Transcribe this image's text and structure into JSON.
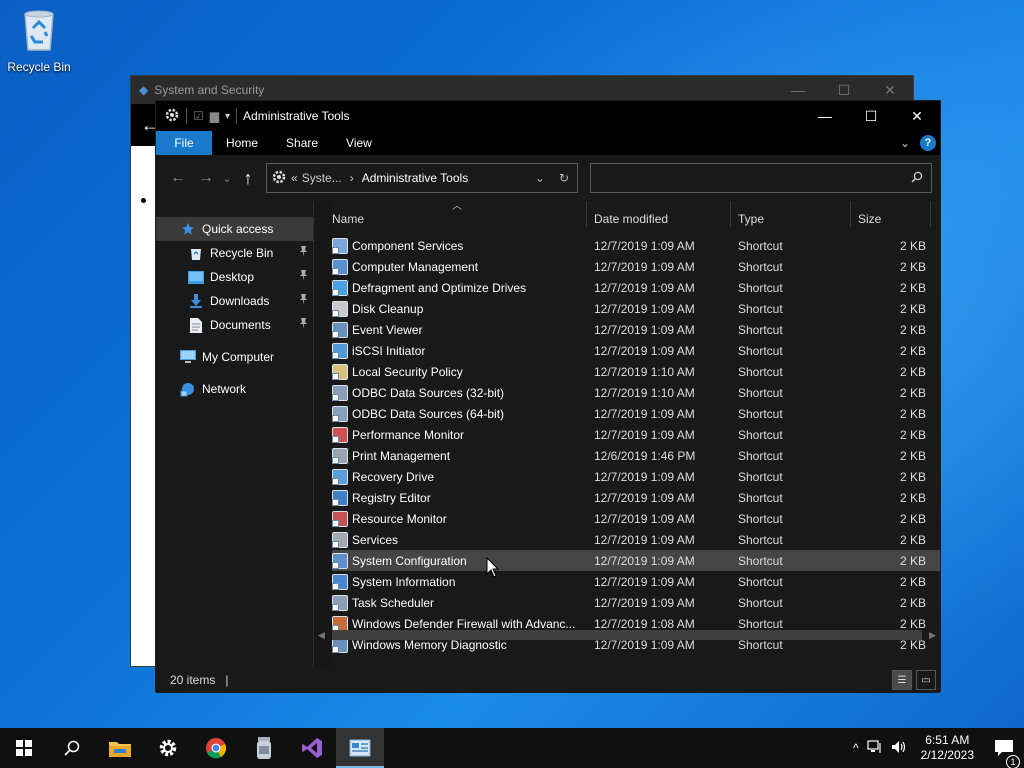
{
  "desktop": {
    "icons": [
      {
        "label": "Recycle Bin",
        "icon": "recycle-bin-icon"
      }
    ]
  },
  "background_window": {
    "title": "System and Security",
    "controls": [
      "—",
      "☐",
      "✕"
    ]
  },
  "explorer": {
    "title": "Administrative Tools",
    "window_controls": {
      "minimize": "—",
      "maximize": "☐",
      "close": "✕"
    },
    "ribbon": {
      "tabs": [
        {
          "label": "File",
          "active": true
        },
        {
          "label": "Home"
        },
        {
          "label": "Share"
        },
        {
          "label": "View"
        }
      ],
      "help": "?"
    },
    "address": {
      "prefix": "«",
      "crumbs": [
        "Syste...",
        "›",
        "Administrative Tools"
      ],
      "dropdown": "⌄",
      "refresh": "↻"
    },
    "search": {
      "placeholder": "",
      "icon": "search-icon"
    },
    "sidebar": {
      "items": [
        {
          "label": "Quick access",
          "icon": "star-icon",
          "selected": true,
          "pinned": false
        },
        {
          "label": "Recycle Bin",
          "icon": "recycle-bin-icon",
          "pinned": true
        },
        {
          "label": "Desktop",
          "icon": "desktop-folder-icon",
          "pinned": true
        },
        {
          "label": "Downloads",
          "icon": "downloads-icon",
          "pinned": true
        },
        {
          "label": "Documents",
          "icon": "documents-icon",
          "pinned": true
        },
        {
          "label": "My Computer",
          "icon": "computer-icon"
        },
        {
          "label": "Network",
          "icon": "network-icon"
        }
      ]
    },
    "columns": [
      "Name",
      "Date modified",
      "Type",
      "Size"
    ],
    "files": [
      {
        "name": "Component Services",
        "date": "12/7/2019 1:09 AM",
        "type": "Shortcut",
        "size": "2 KB",
        "color": "#7aa6d8"
      },
      {
        "name": "Computer Management",
        "date": "12/7/2019 1:09 AM",
        "type": "Shortcut",
        "size": "2 KB",
        "color": "#5b8fd0"
      },
      {
        "name": "Defragment and Optimize Drives",
        "date": "12/7/2019 1:09 AM",
        "type": "Shortcut",
        "size": "2 KB",
        "color": "#4aa0e0"
      },
      {
        "name": "Disk Cleanup",
        "date": "12/7/2019 1:09 AM",
        "type": "Shortcut",
        "size": "2 KB",
        "color": "#c9c9c9"
      },
      {
        "name": "Event Viewer",
        "date": "12/7/2019 1:09 AM",
        "type": "Shortcut",
        "size": "2 KB",
        "color": "#6a8fb8"
      },
      {
        "name": "iSCSI Initiator",
        "date": "12/7/2019 1:09 AM",
        "type": "Shortcut",
        "size": "2 KB",
        "color": "#4f9bd6"
      },
      {
        "name": "Local Security Policy",
        "date": "12/7/2019 1:10 AM",
        "type": "Shortcut",
        "size": "2 KB",
        "color": "#d8c27a"
      },
      {
        "name": "ODBC Data Sources (32-bit)",
        "date": "12/7/2019 1:10 AM",
        "type": "Shortcut",
        "size": "2 KB",
        "color": "#8aa0b8"
      },
      {
        "name": "ODBC Data Sources (64-bit)",
        "date": "12/7/2019 1:09 AM",
        "type": "Shortcut",
        "size": "2 KB",
        "color": "#8aa0b8"
      },
      {
        "name": "Performance Monitor",
        "date": "12/7/2019 1:09 AM",
        "type": "Shortcut",
        "size": "2 KB",
        "color": "#d05050"
      },
      {
        "name": "Print Management",
        "date": "12/6/2019 1:46 PM",
        "type": "Shortcut",
        "size": "2 KB",
        "color": "#9aa4ae"
      },
      {
        "name": "Recovery Drive",
        "date": "12/7/2019 1:09 AM",
        "type": "Shortcut",
        "size": "2 KB",
        "color": "#5aa0d8"
      },
      {
        "name": "Registry Editor",
        "date": "12/7/2019 1:09 AM",
        "type": "Shortcut",
        "size": "2 KB",
        "color": "#3f7fc8"
      },
      {
        "name": "Resource Monitor",
        "date": "12/7/2019 1:09 AM",
        "type": "Shortcut",
        "size": "2 KB",
        "color": "#c85050"
      },
      {
        "name": "Services",
        "date": "12/7/2019 1:09 AM",
        "type": "Shortcut",
        "size": "2 KB",
        "color": "#a0a8b0"
      },
      {
        "name": "System Configuration",
        "date": "12/7/2019 1:09 AM",
        "type": "Shortcut",
        "size": "2 KB",
        "color": "#5f8fc8",
        "highlighted": true
      },
      {
        "name": "System Information",
        "date": "12/7/2019 1:09 AM",
        "type": "Shortcut",
        "size": "2 KB",
        "color": "#4a86cf"
      },
      {
        "name": "Task Scheduler",
        "date": "12/7/2019 1:09 AM",
        "type": "Shortcut",
        "size": "2 KB",
        "color": "#8aa0b8"
      },
      {
        "name": "Windows Defender Firewall with Advanc...",
        "date": "12/7/2019 1:08 AM",
        "type": "Shortcut",
        "size": "2 KB",
        "color": "#c86a3a"
      },
      {
        "name": "Windows Memory Diagnostic",
        "date": "12/7/2019 1:09 AM",
        "type": "Shortcut",
        "size": "2 KB",
        "color": "#6a8fb8"
      }
    ],
    "status": {
      "items_count": "20 items",
      "separator": "|"
    }
  },
  "taskbar": {
    "apps": [
      {
        "name": "start-button",
        "icon": "windows-logo-icon"
      },
      {
        "name": "search-button",
        "icon": "search-icon"
      },
      {
        "name": "file-explorer",
        "icon": "folder-icon"
      },
      {
        "name": "settings",
        "icon": "gear-icon"
      },
      {
        "name": "chrome",
        "icon": "chrome-icon"
      },
      {
        "name": "app-jar",
        "icon": "jar-icon"
      },
      {
        "name": "visual-studio",
        "icon": "visual-studio-icon"
      },
      {
        "name": "control-panel",
        "icon": "control-panel-icon",
        "active": true
      }
    ],
    "tray": {
      "chevron": "^",
      "time": "6:51 AM",
      "date": "2/12/2023",
      "notification_count": "1"
    }
  }
}
